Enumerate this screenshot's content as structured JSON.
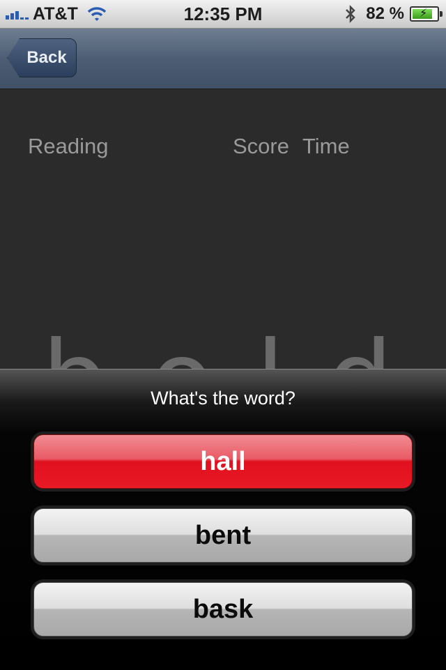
{
  "status_bar": {
    "carrier": "AT&T",
    "time": "12:35 PM",
    "battery_percent": "82 %",
    "battery_level": 0.82,
    "icons": [
      "signal-icon",
      "wifi-icon",
      "bluetooth-icon",
      "battery-icon"
    ]
  },
  "nav": {
    "back_label": "Back"
  },
  "game": {
    "reading_label": "Reading",
    "score_label": "Score",
    "time_label": "Time",
    "word": "bold"
  },
  "sheet": {
    "prompt": "What's the word?",
    "options": [
      "hall",
      "bent",
      "bask"
    ]
  },
  "colors": {
    "selected_option": "#e0101e",
    "nav_bar": "#4d5d73"
  }
}
